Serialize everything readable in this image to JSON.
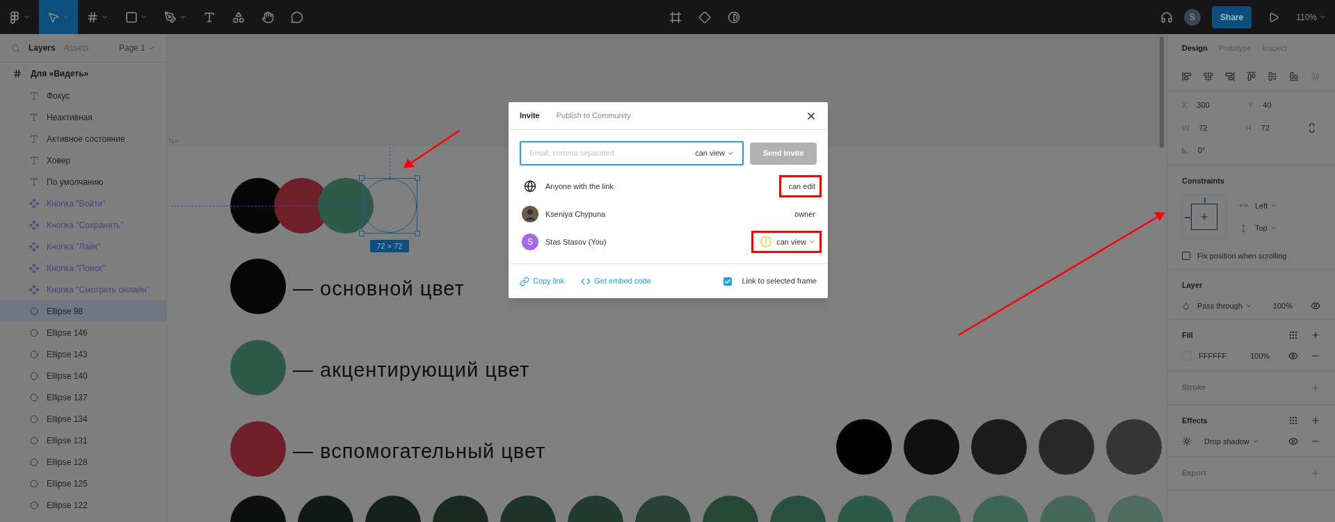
{
  "toolbar": {
    "tools": [
      {
        "kind": "menu",
        "selected": false
      },
      {
        "kind": "move",
        "selected": true
      },
      {
        "kind": "frame",
        "selected": false
      },
      {
        "kind": "shape",
        "selected": false
      },
      {
        "kind": "pen",
        "selected": false
      },
      {
        "kind": "text",
        "selected": false
      },
      {
        "kind": "resources",
        "selected": false
      },
      {
        "kind": "hand",
        "selected": false
      },
      {
        "kind": "comment",
        "selected": false
      }
    ],
    "avatar": "S",
    "share": "Share",
    "zoom": "110%"
  },
  "layers_panel": {
    "tabs": [
      {
        "label": "Layers",
        "selected": true
      },
      {
        "label": "Assets",
        "selected": false
      }
    ],
    "page": "Page 1",
    "frame": {
      "name": "Для «Видеть»",
      "children": [
        {
          "name": "Фокус",
          "kind": "text",
          "selected": false
        },
        {
          "name": "Неактивная",
          "kind": "text",
          "selected": false
        },
        {
          "name": "Активное состояние",
          "kind": "text",
          "selected": false
        },
        {
          "name": "Ховер",
          "kind": "text",
          "selected": false
        },
        {
          "name": "По умолчанию",
          "kind": "text",
          "selected": false
        },
        {
          "name": "Кнопка \"Войти\"",
          "kind": "component",
          "selected": false
        },
        {
          "name": "Кнопка \"Сохранить\"",
          "kind": "component",
          "selected": false
        },
        {
          "name": "Кнопка \"Лайк\"",
          "kind": "component",
          "selected": false
        },
        {
          "name": "Кнопка \"Поиск\"",
          "kind": "component",
          "selected": false
        },
        {
          "name": "Кнопка \"Смотреть онлайн\"",
          "kind": "component",
          "selected": false
        },
        {
          "name": "Ellipse 98",
          "kind": "ellipse",
          "selected": true
        },
        {
          "name": "Ellipse 146",
          "kind": "ellipse",
          "selected": false
        },
        {
          "name": "Ellipse 143",
          "kind": "ellipse",
          "selected": false
        },
        {
          "name": "Ellipse 140",
          "kind": "ellipse",
          "selected": false
        },
        {
          "name": "Ellipse 137",
          "kind": "ellipse",
          "selected": false
        },
        {
          "name": "Ellipse 134",
          "kind": "ellipse",
          "selected": false
        },
        {
          "name": "Ellipse 131",
          "kind": "ellipse",
          "selected": false
        },
        {
          "name": "Ellipse 128",
          "kind": "ellipse",
          "selected": false
        },
        {
          "name": "Ellipse 125",
          "kind": "ellipse",
          "selected": false
        },
        {
          "name": "Ellipse 122",
          "kind": "ellipse",
          "selected": false
        }
      ]
    }
  },
  "canvas": {
    "frame_label": "ть»",
    "swatches": [
      {
        "color": "#060606"
      },
      {
        "color": "#6e1f2a"
      },
      {
        "color": "#2d5a49"
      }
    ],
    "selection_size": "72 × 72",
    "legend": [
      {
        "color": "#060606",
        "label": "— основной цвет"
      },
      {
        "color": "#2d5a49",
        "label": "— акцентирующий цвет"
      },
      {
        "color": "#6e1f2a",
        "label": "— вспомогательный цвет"
      }
    ],
    "gray_row": [
      {
        "color": "#020202"
      },
      {
        "color": "#101010"
      },
      {
        "color": "#1c1c1c"
      },
      {
        "color": "#292929"
      },
      {
        "color": "#363636"
      }
    ],
    "green_row": [
      {
        "color": "#0c110f"
      },
      {
        "color": "#111a16"
      },
      {
        "color": "#15211c"
      },
      {
        "color": "#1a2a23"
      },
      {
        "color": "#1e3329"
      },
      {
        "color": "#223b2f"
      },
      {
        "color": "#264335"
      },
      {
        "color": "#254836"
      },
      {
        "color": "#28513f"
      },
      {
        "color": "#2c5a46"
      },
      {
        "color": "#366050"
      },
      {
        "color": "#3e6656"
      },
      {
        "color": "#46695a"
      },
      {
        "color": "#4e6c60"
      }
    ]
  },
  "dialog": {
    "tabs": [
      {
        "label": "Invite",
        "selected": true
      },
      {
        "label": "Publish to Community",
        "selected": false
      }
    ],
    "email": {
      "placeholder": "Email, comma separated",
      "permission": "can view"
    },
    "send": {
      "label": "Send invite",
      "disabled": true
    },
    "people": [
      {
        "kind": "link",
        "name": "Anyone with the link",
        "role": "can edit",
        "dropdown": false,
        "warning": false,
        "highlighted": true
      },
      {
        "kind": "photo",
        "name": "Kseniya Chypuna",
        "role": "owner",
        "dropdown": false,
        "warning": false,
        "highlighted": false
      },
      {
        "kind": "initial",
        "initial": "S",
        "name": "Stas Stasov (You)",
        "role": "can view",
        "dropdown": true,
        "warning": true,
        "highlighted": true
      }
    ],
    "copy_link": "Copy link",
    "embed": "Get embed code",
    "link_frame": {
      "label": "Link to selected frame",
      "checked": true
    }
  },
  "design_panel": {
    "tabs": [
      {
        "label": "Design",
        "selected": true
      },
      {
        "label": "Prototype",
        "selected": false
      },
      {
        "label": "Inspect",
        "selected": false
      }
    ],
    "x": {
      "label": "X",
      "value": "300"
    },
    "y": {
      "label": "Y",
      "value": "40"
    },
    "w": {
      "label": "W",
      "value": "72"
    },
    "h": {
      "label": "H",
      "value": "72"
    },
    "rotation": "0°",
    "constraints": {
      "title": "Constraints",
      "horizontal": "Left",
      "vertical": "Top",
      "fix": {
        "label": "Fix position when scrolling",
        "checked": false
      }
    },
    "layer": {
      "title": "Layer",
      "blend": "Pass through",
      "opacity": "100%"
    },
    "fill": {
      "title": "Fill",
      "hex": "FFFFFF",
      "opacity": "100%"
    },
    "stroke": {
      "title": "Stroke"
    },
    "effects": {
      "title": "Effects",
      "effect": "Drop shadow"
    },
    "export": {
      "title": "Export"
    }
  }
}
